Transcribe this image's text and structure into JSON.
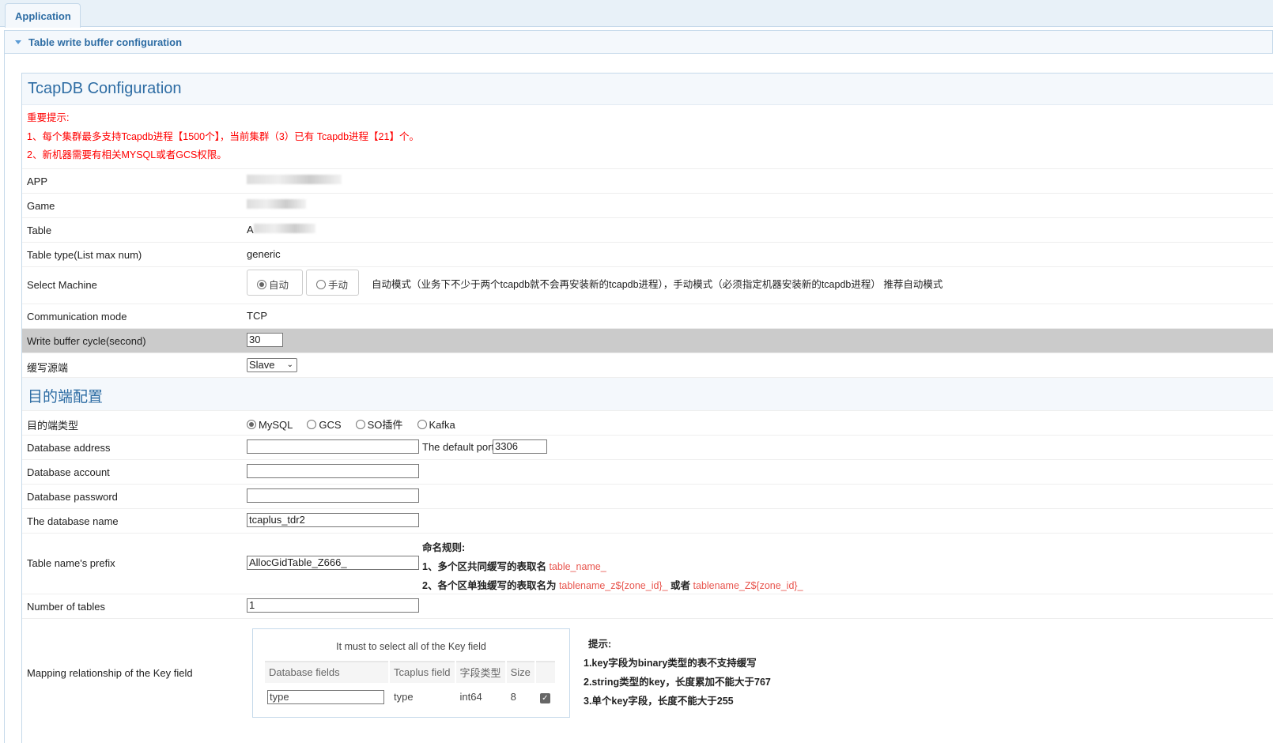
{
  "tabs": [
    "Application"
  ],
  "panel_title": "Table write buffer configuration",
  "section_title": "TcapDB Configuration",
  "warnings": [
    "重要提示:",
    "1、每个集群最多支持Tcapdb进程【1500个】，当前集群（3）已有 Tcapdb进程【21】个。",
    "2、新机器需要有相关MYSQL或者GCS权限。"
  ],
  "fields": {
    "app": {
      "label": "APP"
    },
    "game": {
      "label": "Game"
    },
    "table": {
      "label": "Table",
      "value_prefix": "A"
    },
    "table_type": {
      "label": "Table type(List max num)",
      "value": "generic"
    },
    "select_machine": {
      "label": "Select Machine",
      "options": [
        "自动",
        "手动"
      ],
      "selected": "自动",
      "hint": "自动模式（业务下不少于两个tcapdb就不会再安装新的tcapdb进程），手动模式（必须指定机器安装新的tcapdb进程） 推荐自动模式"
    },
    "comm_mode": {
      "label": "Communication mode",
      "value": "TCP"
    },
    "write_cycle": {
      "label": "Write buffer cycle(second)",
      "value": "30"
    },
    "source": {
      "label": "缓写源端",
      "value": "Slave"
    }
  },
  "dest_section": "目的端配置",
  "dest": {
    "type": {
      "label": "目的端类型",
      "options": [
        "MySQL",
        "GCS",
        "SO插件",
        "Kafka"
      ],
      "selected": "MySQL"
    },
    "address": {
      "label": "Database address",
      "value": "",
      "port_label": "The default port",
      "port": "3306"
    },
    "account": {
      "label": "Database account",
      "value": ""
    },
    "password": {
      "label": "Database password",
      "value": ""
    },
    "dbname": {
      "label": "The database name",
      "value": "tcaplus_tdr2"
    },
    "prefix": {
      "label": "Table name's prefix",
      "value": "AllocGidTable_Z666_",
      "rule_title": "命名规则:",
      "rule1": "1、多个区共同缓写的表取名 ",
      "rule1_code": "table_name_",
      "rule2": "2、各个区单独缓写的表取名为 ",
      "rule2_code1": "tablename_z${zone_id}_",
      "rule2_or": " 或者 ",
      "rule2_code2": "tablename_Z${zone_id}_"
    },
    "num_tables": {
      "label": "Number of tables",
      "value": "1"
    },
    "mapping": {
      "label": "Mapping relationship of the Key field",
      "caption": "It must to select all of the Key field",
      "headers": [
        "Database fields",
        "Tcaplus field",
        "字段类型",
        "Size",
        ""
      ],
      "rows": [
        {
          "db_field": "type",
          "tcaplus_field": "type",
          "type": "int64",
          "size": "8",
          "checked": true
        }
      ],
      "tips": [
        "提示:",
        "1.key字段为binary类型的表不支持缓写",
        "2.string类型的key，长度累加不能大于767",
        "3.单个key字段，长度不能大于255"
      ]
    }
  }
}
